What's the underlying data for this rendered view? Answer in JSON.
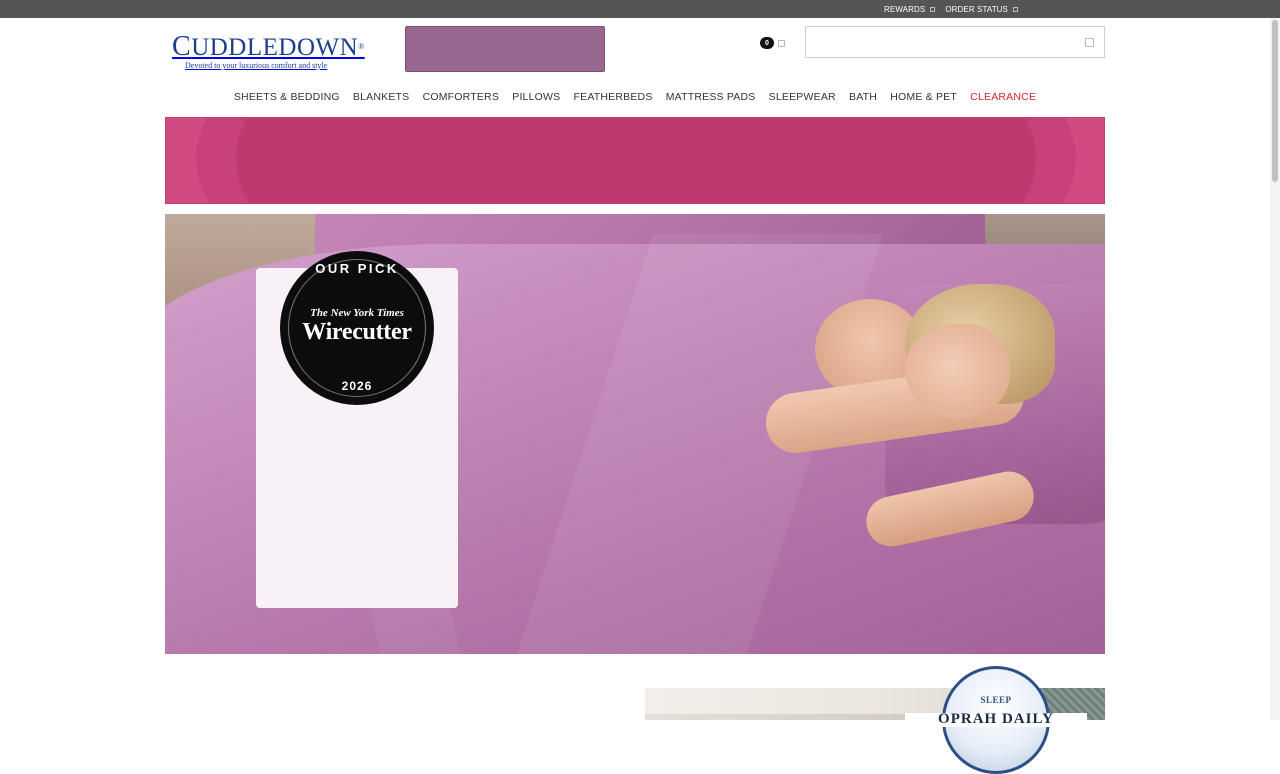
{
  "topbar": {
    "links": [
      {
        "label": "REWARDS"
      },
      {
        "label": "ORDER STATUS"
      }
    ]
  },
  "header": {
    "logo_name": "Cuddledown",
    "logo_tagline": "Devoted to your luxurious comfort and style",
    "cart_count": "0",
    "search_placeholder": ""
  },
  "nav": {
    "items": [
      {
        "label": "SHEETS & BEDDING"
      },
      {
        "label": "BLANKETS"
      },
      {
        "label": "COMFORTERS"
      },
      {
        "label": "PILLOWS"
      },
      {
        "label": "FEATHERBEDS"
      },
      {
        "label": "MATTRESS PADS"
      },
      {
        "label": "SLEEPWEAR"
      },
      {
        "label": "BATH"
      },
      {
        "label": "HOME & PET"
      },
      {
        "label": "CLEARANCE"
      }
    ]
  },
  "hero": {
    "badge_top": "OUR PICK",
    "badge_publisher": "The New York Times",
    "badge_brand": "Wirecutter",
    "badge_year": "2026"
  },
  "bottom": {
    "badge_text": "SLEEP",
    "badge_band": "OPRAH DAILY"
  },
  "colors": {
    "topbar": "#555555",
    "brand_blue": "#1d3f8e",
    "promo_button": "#98678f",
    "clearance_red": "#d2262c",
    "banner_pink": "#d14b82",
    "hero_purple": "#b070a5"
  }
}
